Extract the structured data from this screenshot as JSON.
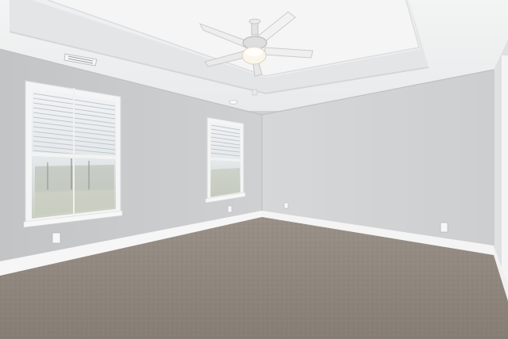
{
  "scene": {
    "subject": "empty room",
    "elements": [
      "tray-ceiling",
      "ceiling-fan-with-light",
      "hvac-vent",
      "left-window-with-blinds",
      "center-window-with-blinds",
      "wall-outlets",
      "white-baseboards",
      "carpet-floor"
    ]
  },
  "colors": {
    "ceiling": "#f1f2f2",
    "tray": "#e6e7e8",
    "left_wall": "#c8c9cb",
    "back_wall": "#d2d3d5",
    "right_wall": "#dcdddf",
    "trim": "#f7f7f7",
    "carpet": "#8f867d",
    "window_glass": "#e7ecef"
  }
}
